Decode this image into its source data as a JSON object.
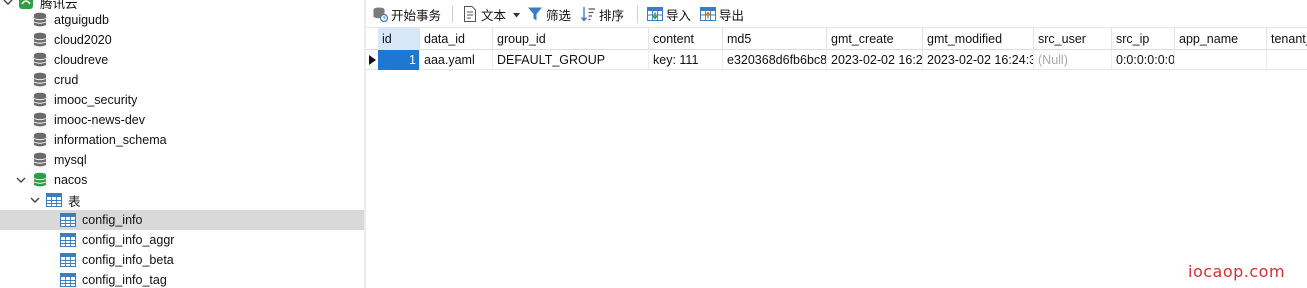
{
  "tree": {
    "root_label": "腾讯云",
    "items": [
      {
        "label": "atguigudb",
        "icon": "database-icon"
      },
      {
        "label": "cloud2020",
        "icon": "database-icon"
      },
      {
        "label": "cloudreve",
        "icon": "database-icon"
      },
      {
        "label": "crud",
        "icon": "database-icon"
      },
      {
        "label": "imooc_security",
        "icon": "database-icon"
      },
      {
        "label": "imooc-news-dev",
        "icon": "database-icon"
      },
      {
        "label": "information_schema",
        "icon": "database-icon"
      },
      {
        "label": "mysql",
        "icon": "database-icon"
      },
      {
        "label": "nacos",
        "icon": "database-open-icon"
      },
      {
        "label": "表",
        "icon": "tables-folder-icon"
      },
      {
        "label": "config_info",
        "icon": "table-icon"
      },
      {
        "label": "config_info_aggr",
        "icon": "table-icon"
      },
      {
        "label": "config_info_beta",
        "icon": "table-icon"
      },
      {
        "label": "config_info_tag",
        "icon": "table-icon"
      }
    ],
    "selected_item": "config_info"
  },
  "toolbar": {
    "begin_transaction": "开始事务",
    "text": "文本",
    "filter": "筛选",
    "sort": "排序",
    "import": "导入",
    "export": "导出"
  },
  "grid": {
    "columns": [
      "id",
      "data_id",
      "group_id",
      "content",
      "md5",
      "gmt_create",
      "gmt_modified",
      "src_user",
      "src_ip",
      "app_name",
      "tenant_"
    ],
    "rows": [
      [
        "1",
        "aaa.yaml",
        "DEFAULT_GROUP",
        "key: 111",
        "e320368d6fb6bc8",
        "2023-02-02 16:2",
        "2023-02-02 16:24:3",
        "(Null)",
        "0:0:0:0:0:0:",
        "",
        ""
      ]
    ]
  },
  "watermark": "iocaop.com",
  "colors": {
    "selection": "#1f77d4",
    "row_highlight": "#d9d9d9",
    "db_icon": "#6b6b6b",
    "db_active_icon": "#2f9e44",
    "table_icon": "#3b7dc4",
    "watermark": "#d63030"
  }
}
